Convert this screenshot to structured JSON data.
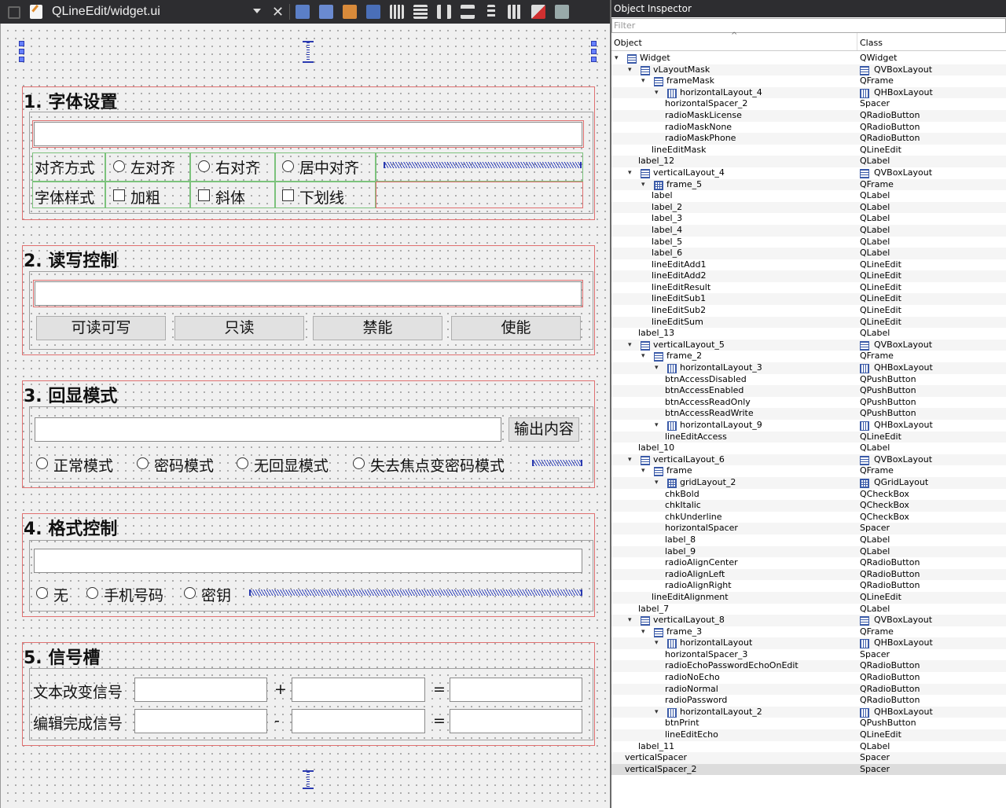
{
  "window": {
    "title": "QLineEdit/widget.ui"
  },
  "inspector": {
    "title": "Object Inspector",
    "filter_placeholder": "Filter",
    "col_object": "Object",
    "col_class": "Class",
    "rows": [
      {
        "name": "Widget",
        "cls": "QWidget",
        "depth": 0,
        "arrow": true,
        "icon": "vbox",
        "cicon": ""
      },
      {
        "name": "vLayoutMask",
        "cls": "QVBoxLayout",
        "depth": 1,
        "arrow": true,
        "icon": "vbox",
        "cicon": "vbox"
      },
      {
        "name": "frameMask",
        "cls": "QFrame",
        "depth": 2,
        "arrow": true,
        "icon": "vbox",
        "cicon": ""
      },
      {
        "name": "horizontalLayout_4",
        "cls": "QHBoxLayout",
        "depth": 3,
        "arrow": true,
        "icon": "hbox",
        "cicon": "hbox"
      },
      {
        "name": "horizontalSpacer_2",
        "cls": "Spacer",
        "depth": 4,
        "arrow": false,
        "icon": "",
        "cicon": ""
      },
      {
        "name": "radioMaskLicense",
        "cls": "QRadioButton",
        "depth": 4,
        "arrow": false,
        "icon": "",
        "cicon": ""
      },
      {
        "name": "radioMaskNone",
        "cls": "QRadioButton",
        "depth": 4,
        "arrow": false,
        "icon": "",
        "cicon": ""
      },
      {
        "name": "radioMaskPhone",
        "cls": "QRadioButton",
        "depth": 4,
        "arrow": false,
        "icon": "",
        "cicon": ""
      },
      {
        "name": "lineEditMask",
        "cls": "QLineEdit",
        "depth": 3,
        "arrow": false,
        "icon": "",
        "cicon": ""
      },
      {
        "name": "label_12",
        "cls": "QLabel",
        "depth": 2,
        "arrow": false,
        "icon": "",
        "cicon": ""
      },
      {
        "name": "verticalLayout_4",
        "cls": "QVBoxLayout",
        "depth": 1,
        "arrow": true,
        "icon": "vbox",
        "cicon": "vbox"
      },
      {
        "name": "frame_5",
        "cls": "QFrame",
        "depth": 2,
        "arrow": true,
        "icon": "grid",
        "cicon": ""
      },
      {
        "name": "label",
        "cls": "QLabel",
        "depth": 3,
        "arrow": false,
        "icon": "",
        "cicon": ""
      },
      {
        "name": "label_2",
        "cls": "QLabel",
        "depth": 3,
        "arrow": false,
        "icon": "",
        "cicon": ""
      },
      {
        "name": "label_3",
        "cls": "QLabel",
        "depth": 3,
        "arrow": false,
        "icon": "",
        "cicon": ""
      },
      {
        "name": "label_4",
        "cls": "QLabel",
        "depth": 3,
        "arrow": false,
        "icon": "",
        "cicon": ""
      },
      {
        "name": "label_5",
        "cls": "QLabel",
        "depth": 3,
        "arrow": false,
        "icon": "",
        "cicon": ""
      },
      {
        "name": "label_6",
        "cls": "QLabel",
        "depth": 3,
        "arrow": false,
        "icon": "",
        "cicon": ""
      },
      {
        "name": "lineEditAdd1",
        "cls": "QLineEdit",
        "depth": 3,
        "arrow": false,
        "icon": "",
        "cicon": ""
      },
      {
        "name": "lineEditAdd2",
        "cls": "QLineEdit",
        "depth": 3,
        "arrow": false,
        "icon": "",
        "cicon": ""
      },
      {
        "name": "lineEditResult",
        "cls": "QLineEdit",
        "depth": 3,
        "arrow": false,
        "icon": "",
        "cicon": ""
      },
      {
        "name": "lineEditSub1",
        "cls": "QLineEdit",
        "depth": 3,
        "arrow": false,
        "icon": "",
        "cicon": ""
      },
      {
        "name": "lineEditSub2",
        "cls": "QLineEdit",
        "depth": 3,
        "arrow": false,
        "icon": "",
        "cicon": ""
      },
      {
        "name": "lineEditSum",
        "cls": "QLineEdit",
        "depth": 3,
        "arrow": false,
        "icon": "",
        "cicon": ""
      },
      {
        "name": "label_13",
        "cls": "QLabel",
        "depth": 2,
        "arrow": false,
        "icon": "",
        "cicon": ""
      },
      {
        "name": "verticalLayout_5",
        "cls": "QVBoxLayout",
        "depth": 1,
        "arrow": true,
        "icon": "vbox",
        "cicon": "vbox"
      },
      {
        "name": "frame_2",
        "cls": "QFrame",
        "depth": 2,
        "arrow": true,
        "icon": "vbox",
        "cicon": ""
      },
      {
        "name": "horizontalLayout_3",
        "cls": "QHBoxLayout",
        "depth": 3,
        "arrow": true,
        "icon": "hbox",
        "cicon": "hbox"
      },
      {
        "name": "btnAccessDisabled",
        "cls": "QPushButton",
        "depth": 4,
        "arrow": false,
        "icon": "",
        "cicon": ""
      },
      {
        "name": "btnAccessEnabled",
        "cls": "QPushButton",
        "depth": 4,
        "arrow": false,
        "icon": "",
        "cicon": ""
      },
      {
        "name": "btnAccessReadOnly",
        "cls": "QPushButton",
        "depth": 4,
        "arrow": false,
        "icon": "",
        "cicon": ""
      },
      {
        "name": "btnAccessReadWrite",
        "cls": "QPushButton",
        "depth": 4,
        "arrow": false,
        "icon": "",
        "cicon": ""
      },
      {
        "name": "horizontalLayout_9",
        "cls": "QHBoxLayout",
        "depth": 3,
        "arrow": true,
        "icon": "hbox",
        "cicon": "hbox"
      },
      {
        "name": "lineEditAccess",
        "cls": "QLineEdit",
        "depth": 4,
        "arrow": false,
        "icon": "",
        "cicon": ""
      },
      {
        "name": "label_10",
        "cls": "QLabel",
        "depth": 2,
        "arrow": false,
        "icon": "",
        "cicon": ""
      },
      {
        "name": "verticalLayout_6",
        "cls": "QVBoxLayout",
        "depth": 1,
        "arrow": true,
        "icon": "vbox",
        "cicon": "vbox"
      },
      {
        "name": "frame",
        "cls": "QFrame",
        "depth": 2,
        "arrow": true,
        "icon": "vbox",
        "cicon": ""
      },
      {
        "name": "gridLayout_2",
        "cls": "QGridLayout",
        "depth": 3,
        "arrow": true,
        "icon": "grid",
        "cicon": "grid"
      },
      {
        "name": "chkBold",
        "cls": "QCheckBox",
        "depth": 4,
        "arrow": false,
        "icon": "",
        "cicon": ""
      },
      {
        "name": "chkItalic",
        "cls": "QCheckBox",
        "depth": 4,
        "arrow": false,
        "icon": "",
        "cicon": ""
      },
      {
        "name": "chkUnderline",
        "cls": "QCheckBox",
        "depth": 4,
        "arrow": false,
        "icon": "",
        "cicon": ""
      },
      {
        "name": "horizontalSpacer",
        "cls": "Spacer",
        "depth": 4,
        "arrow": false,
        "icon": "",
        "cicon": ""
      },
      {
        "name": "label_8",
        "cls": "QLabel",
        "depth": 4,
        "arrow": false,
        "icon": "",
        "cicon": ""
      },
      {
        "name": "label_9",
        "cls": "QLabel",
        "depth": 4,
        "arrow": false,
        "icon": "",
        "cicon": ""
      },
      {
        "name": "radioAlignCenter",
        "cls": "QRadioButton",
        "depth": 4,
        "arrow": false,
        "icon": "",
        "cicon": ""
      },
      {
        "name": "radioAlignLeft",
        "cls": "QRadioButton",
        "depth": 4,
        "arrow": false,
        "icon": "",
        "cicon": ""
      },
      {
        "name": "radioAlignRight",
        "cls": "QRadioButton",
        "depth": 4,
        "arrow": false,
        "icon": "",
        "cicon": ""
      },
      {
        "name": "lineEditAlignment",
        "cls": "QLineEdit",
        "depth": 3,
        "arrow": false,
        "icon": "",
        "cicon": ""
      },
      {
        "name": "label_7",
        "cls": "QLabel",
        "depth": 2,
        "arrow": false,
        "icon": "",
        "cicon": ""
      },
      {
        "name": "verticalLayout_8",
        "cls": "QVBoxLayout",
        "depth": 1,
        "arrow": true,
        "icon": "vbox",
        "cicon": "vbox"
      },
      {
        "name": "frame_3",
        "cls": "QFrame",
        "depth": 2,
        "arrow": true,
        "icon": "vbox",
        "cicon": ""
      },
      {
        "name": "horizontalLayout",
        "cls": "QHBoxLayout",
        "depth": 3,
        "arrow": true,
        "icon": "hbox",
        "cicon": "hbox"
      },
      {
        "name": "horizontalSpacer_3",
        "cls": "Spacer",
        "depth": 4,
        "arrow": false,
        "icon": "",
        "cicon": ""
      },
      {
        "name": "radioEchoPasswordEchoOnEdit",
        "cls": "QRadioButton",
        "depth": 4,
        "arrow": false,
        "icon": "",
        "cicon": ""
      },
      {
        "name": "radioNoEcho",
        "cls": "QRadioButton",
        "depth": 4,
        "arrow": false,
        "icon": "",
        "cicon": ""
      },
      {
        "name": "radioNormal",
        "cls": "QRadioButton",
        "depth": 4,
        "arrow": false,
        "icon": "",
        "cicon": ""
      },
      {
        "name": "radioPassword",
        "cls": "QRadioButton",
        "depth": 4,
        "arrow": false,
        "icon": "",
        "cicon": ""
      },
      {
        "name": "horizontalLayout_2",
        "cls": "QHBoxLayout",
        "depth": 3,
        "arrow": true,
        "icon": "hbox",
        "cicon": "hbox"
      },
      {
        "name": "btnPrint",
        "cls": "QPushButton",
        "depth": 4,
        "arrow": false,
        "icon": "",
        "cicon": ""
      },
      {
        "name": "lineEditEcho",
        "cls": "QLineEdit",
        "depth": 4,
        "arrow": false,
        "icon": "",
        "cicon": ""
      },
      {
        "name": "label_11",
        "cls": "QLabel",
        "depth": 2,
        "arrow": false,
        "icon": "",
        "cicon": ""
      },
      {
        "name": "verticalSpacer",
        "cls": "Spacer",
        "depth": 1,
        "arrow": false,
        "icon": "",
        "cicon": ""
      },
      {
        "name": "verticalSpacer_2",
        "cls": "Spacer",
        "depth": 1,
        "arrow": false,
        "icon": "",
        "cicon": ""
      }
    ]
  },
  "form": {
    "s1": {
      "title": "1. 字体设置",
      "align_label": "对齐方式",
      "align_left": "左对齐",
      "align_right": "右对齐",
      "align_center": "居中对齐",
      "style_label": "字体样式",
      "bold": "加粗",
      "italic": "斜体",
      "underline": "下划线"
    },
    "s2": {
      "title": "2. 读写控制",
      "rw": "可读可写",
      "ro": "只读",
      "disabled": "禁能",
      "enabled": "使能"
    },
    "s3": {
      "title": "3. 回显模式",
      "print": "输出内容",
      "normal": "正常模式",
      "password": "密码模式",
      "noecho": "无回显模式",
      "onedit": "失去焦点变密码模式"
    },
    "s4": {
      "title": "4. 格式控制",
      "none": "无",
      "phone": "手机号码",
      "license": "密钥"
    },
    "s5": {
      "title": "5. 信号槽",
      "changed": "文本改变信号",
      "finished": "编辑完成信号",
      "plus": "+",
      "minus": "-",
      "eq1": "=",
      "eq2": "="
    }
  }
}
